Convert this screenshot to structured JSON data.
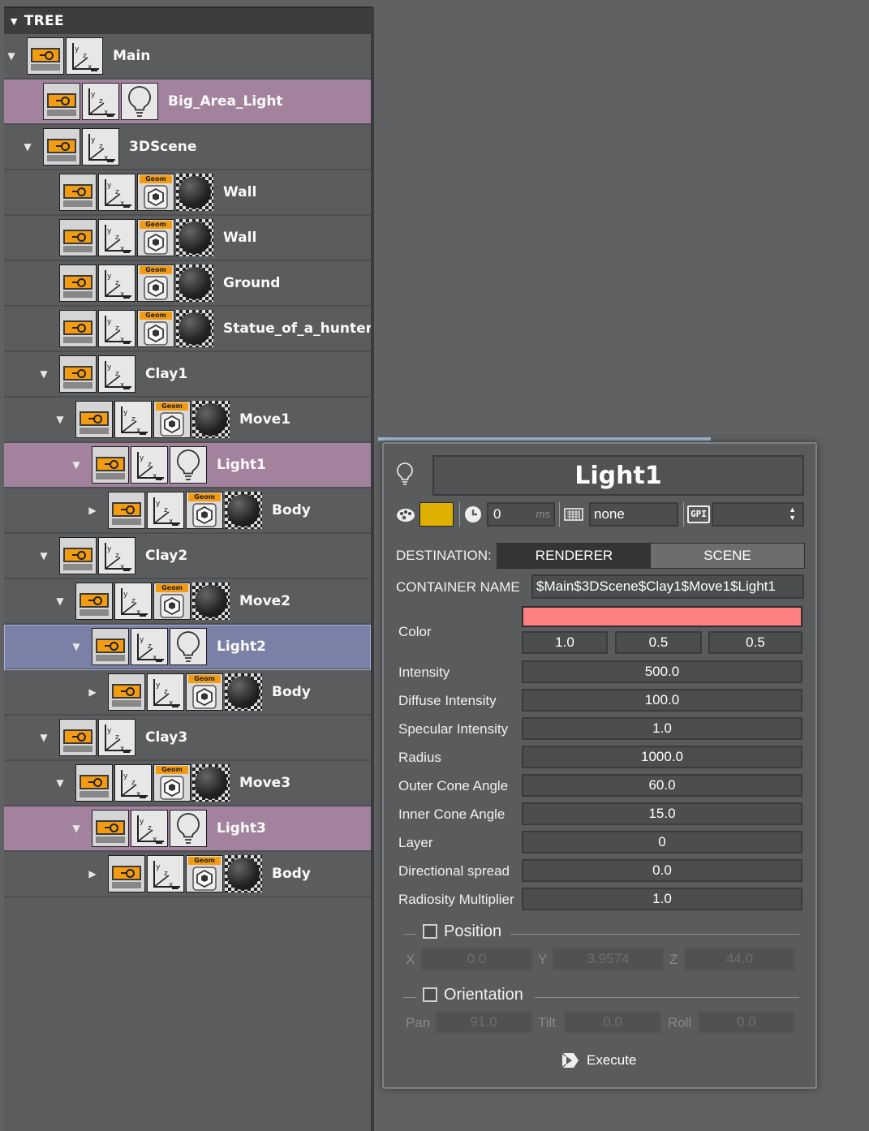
{
  "tree": {
    "header": "TREE",
    "nodes": [
      {
        "label": "Main",
        "expander": "▼"
      },
      {
        "label": "Big_Area_Light",
        "expander": ""
      },
      {
        "label": "3DScene",
        "expander": "▼"
      },
      {
        "label": "Wall",
        "expander": ""
      },
      {
        "label": "Wall",
        "expander": ""
      },
      {
        "label": "Ground",
        "expander": ""
      },
      {
        "label": "Statue_of_a_hunter",
        "expander": ""
      },
      {
        "label": "Clay1",
        "expander": "▼"
      },
      {
        "label": "Move1",
        "expander": "▼"
      },
      {
        "label": "Light1",
        "expander": "▼"
      },
      {
        "label": "Body",
        "expander": "▶"
      },
      {
        "label": "Clay2",
        "expander": "▼"
      },
      {
        "label": "Move2",
        "expander": "▼"
      },
      {
        "label": "Light2",
        "expander": "▼"
      },
      {
        "label": "Body",
        "expander": "▶"
      },
      {
        "label": "Clay3",
        "expander": "▼"
      },
      {
        "label": "Move3",
        "expander": "▼"
      },
      {
        "label": "Light3",
        "expander": "▼"
      },
      {
        "label": "Body",
        "expander": "▶"
      }
    ],
    "geom_label": "Geom"
  },
  "props": {
    "title": "Light1",
    "swatch_color": "#e0b000",
    "delay_value": "0",
    "delay_unit": "ms",
    "key_value": "none",
    "gpi_label": "GPI",
    "destination_label": "DESTINATION:",
    "dest_renderer": "RENDERER",
    "dest_scene": "SCENE",
    "container_label": "CONTAINER NAME",
    "container_value": "$Main$3DScene$Clay1$Move1$Light1",
    "color_label": "Color",
    "color_preview": "#ff8080",
    "color_r": "1.0",
    "color_g": "0.5",
    "color_b": "0.5",
    "fields": [
      {
        "label": "Intensity",
        "value": "500.0"
      },
      {
        "label": "Diffuse Intensity",
        "value": "100.0"
      },
      {
        "label": "Specular Intensity",
        "value": "1.0"
      },
      {
        "label": "Radius",
        "value": "1000.0"
      },
      {
        "label": "Outer Cone Angle",
        "value": "60.0"
      },
      {
        "label": "Inner Cone Angle",
        "value": "15.0"
      },
      {
        "label": "Layer",
        "value": "0"
      },
      {
        "label": "Directional spread",
        "value": "0.0"
      },
      {
        "label": "Radiosity Multiplier",
        "value": "1.0"
      }
    ],
    "position": {
      "label": "Position",
      "x_label": "X",
      "x": "0.0",
      "y_label": "Y",
      "y": "3.9574",
      "z_label": "Z",
      "z": "44.0"
    },
    "orientation": {
      "label": "Orientation",
      "pan_label": "Pan",
      "pan": "91.0",
      "tilt_label": "Tilt",
      "tilt": "0.0",
      "roll_label": "Roll",
      "roll": "0.0"
    },
    "execute_label": "Execute"
  }
}
